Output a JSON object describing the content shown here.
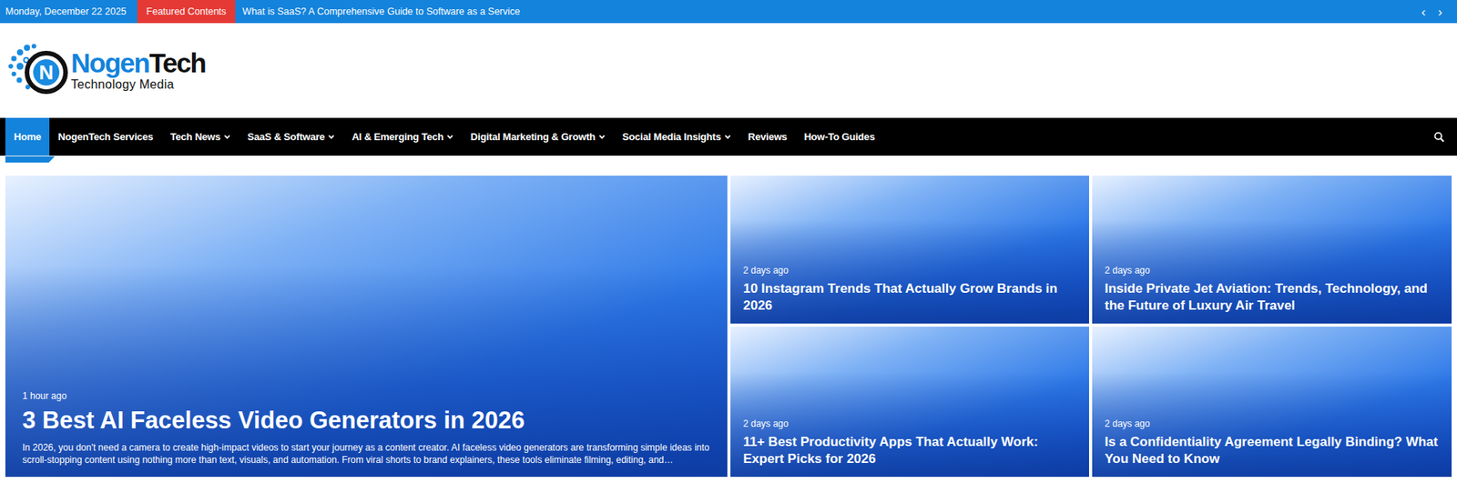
{
  "top_bar": {
    "date": "Monday, December 22 2025",
    "featured_label": "Featured Contents",
    "ticker_headline": "What is SaaS? A Comprehensive Guide to Software as a Service",
    "arrows": [
      "‹",
      "›"
    ]
  },
  "logo": {
    "mark": "N",
    "name_first": "Nogen",
    "name_second": "Tech",
    "tagline": "Technology Media"
  },
  "nav": [
    {
      "label": "Home",
      "selected": true,
      "has_dropdown": false
    },
    {
      "label": "NogenTech Services",
      "selected": false,
      "has_dropdown": false
    },
    {
      "label": "Tech News",
      "selected": false,
      "has_dropdown": true
    },
    {
      "label": "SaaS & Software",
      "selected": false,
      "has_dropdown": true
    },
    {
      "label": "AI & Emerging Tech",
      "selected": false,
      "has_dropdown": true
    },
    {
      "label": "Digital Marketing & Growth",
      "selected": false,
      "has_dropdown": true
    },
    {
      "label": "Social Media Insights",
      "selected": false,
      "has_dropdown": true
    },
    {
      "label": "Reviews",
      "selected": false,
      "has_dropdown": false
    },
    {
      "label": "How-To Guides",
      "selected": false,
      "has_dropdown": false
    }
  ],
  "featured": {
    "time": "1 hour ago",
    "title": "3 Best AI Faceless Video Generators in 2026",
    "excerpt": "In 2026, you don't need a camera to create high-impact videos to start your journey as a content creator. AI faceless video generators are transforming simple ideas into scroll-stopping content using nothing more than text, visuals, and automation. From viral shorts to brand explainers, these tools eliminate filming, editing, and…"
  },
  "cards": [
    {
      "time": "2 days ago",
      "title": "10 Instagram Trends That Actually Grow Brands in 2026"
    },
    {
      "time": "2 days ago",
      "title": "Inside Private Jet Aviation: Trends, Technology, and the Future of Luxury Air Travel"
    },
    {
      "time": "2 days ago",
      "title": "11+ Best Productivity Apps That Actually Work: Expert Picks for 2026"
    },
    {
      "time": "2 days ago",
      "title": "Is a Confidentiality Agreement Legally Binding? What You Need to Know"
    }
  ]
}
